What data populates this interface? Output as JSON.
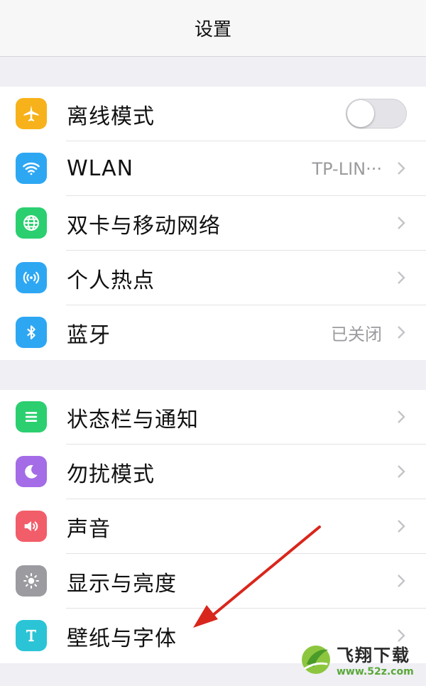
{
  "header": {
    "title": "设置"
  },
  "group1": [
    {
      "label": "离线模式",
      "icon": "airplane-icon",
      "color": "#f7b21b",
      "control": "toggle",
      "toggle_on": false
    },
    {
      "label": "WLAN",
      "icon": "wifi-icon",
      "color": "#2ea7f3",
      "value": "TP-LIN···"
    },
    {
      "label": "双卡与移动网络",
      "icon": "globe-icon",
      "color": "#2bcf6f"
    },
    {
      "label": "个人热点",
      "icon": "hotspot-icon",
      "color": "#2ea7f3"
    },
    {
      "label": "蓝牙",
      "icon": "bluetooth-icon",
      "color": "#2ea7f3",
      "value": "已关闭"
    }
  ],
  "group2": [
    {
      "label": "状态栏与通知",
      "icon": "notification-list-icon",
      "color": "#2bcf6f"
    },
    {
      "label": "勿扰模式",
      "icon": "moon-icon",
      "color": "#a46ce6"
    },
    {
      "label": "声音",
      "icon": "speaker-icon",
      "color": "#f25d6a"
    },
    {
      "label": "显示与亮度",
      "icon": "brightness-icon",
      "color": "#9b9ba0"
    },
    {
      "label": "壁纸与字体",
      "icon": "font-t-icon",
      "color": "#2ac4d6"
    }
  ],
  "annotation": {
    "arrow_color": "#d9261c"
  },
  "watermark": {
    "title": "飞翔下载",
    "url": "www.52z.com"
  }
}
